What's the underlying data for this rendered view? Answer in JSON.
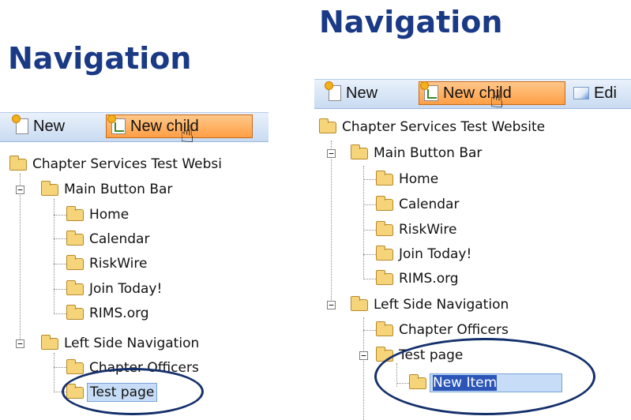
{
  "colors": {
    "heading": "#1a3a86",
    "toolbar": "#d6e4f6",
    "active_button": "#ffb066",
    "selection": "#c7dcf6",
    "ellipse": "#14306b"
  },
  "left": {
    "heading": "Navigation",
    "toolbar": {
      "new_label": "New",
      "new_child_label": "New child"
    },
    "tree": {
      "root": "Chapter Services Test Websi",
      "group1": "Main Button Bar",
      "items1": [
        "Home",
        "Calendar",
        "RiskWire",
        "Join Today!",
        "RIMS.org"
      ],
      "group2": "Left Side Navigation",
      "item_officers": "Chapter Officers",
      "item_test": "Test page"
    }
  },
  "right": {
    "heading": "Navigation",
    "toolbar": {
      "new_label": "New",
      "new_child_label": "New child",
      "edit_label": "Edi"
    },
    "tree": {
      "root": "Chapter Services Test Website",
      "group1": "Main Button Bar",
      "items1": [
        "Home",
        "Calendar",
        "RiskWire",
        "Join Today!",
        "RIMS.org"
      ],
      "group2": "Left Side Navigation",
      "item_officers": "Chapter Officers",
      "item_test": "Test page",
      "new_item": "New Item"
    }
  },
  "icons": [
    "new-page-icon",
    "new-child-icon",
    "edit-icon",
    "folder-icon",
    "hand-cursor-icon",
    "expand-collapse-icon"
  ]
}
